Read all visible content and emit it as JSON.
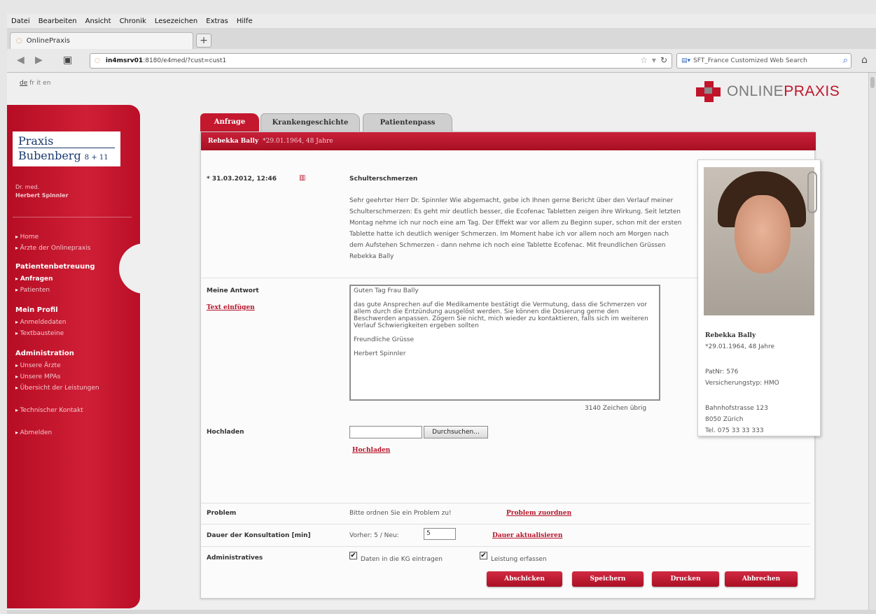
{
  "browser": {
    "menu": [
      "Datei",
      "Bearbeiten",
      "Ansicht",
      "Chronik",
      "Lesezeichen",
      "Extras",
      "Hilfe"
    ],
    "tab_title": "OnlinePraxis",
    "new_tab": "+",
    "url_host": "in4msrv01",
    "url_rest": ":8180/e4med/?cust=cust1",
    "search_placeholder": "SFT_France Customized Web Search"
  },
  "lang": {
    "items": [
      "de",
      "fr",
      "it",
      "en"
    ]
  },
  "brand": {
    "name_gray": "ONLINE",
    "name_red": "PRAXIS",
    "colors": {
      "red": "#c0152b",
      "gray": "#7a7a7a"
    }
  },
  "sidebar": {
    "logo_line1": "Praxis",
    "logo_line2": "Bubenberg",
    "logo_suffix": "8 + 11",
    "doctor_title": "Dr. med.",
    "doctor_name": "Herbert Spinnler",
    "links": {
      "home": "Home",
      "aerzte": "Ärzte der Onlinepraxis",
      "anfragen": "Anfragen",
      "patienten": "Patienten",
      "anmeldedaten": "Anmeldedaten",
      "textbausteine": "Textbausteine",
      "unsere_aerzte": "Unsere Ärzte",
      "unsere_mpas": "Unsere MPAs",
      "uebersicht": "Übersicht der Leistungen",
      "kontakt": "Technischer Kontakt",
      "abmelden": "Abmelden"
    },
    "headings": {
      "patientenbetreuung": "Patientenbetreuung",
      "profil": "Mein Profil",
      "administration": "Administration"
    }
  },
  "tabs": {
    "anfrage": "Anfrage",
    "krankengeschichte": "Krankengeschichte",
    "patientenpass": "Patientenpass"
  },
  "header": {
    "patient": "Rebekka Bally",
    "dob": "*29.01.1964, 48 Jahre"
  },
  "request": {
    "date": "* 31.03.2012, 12:46",
    "subject": "Schulterschmerzen",
    "body": "Sehr geehrter Herr Dr. Spinnler  Wie abgemacht, gebe ich Ihnen gerne Bericht über den Verlauf meiner Schulterschmerzen:  Es geht mir deutlich besser, die Ecofenac Tabletten zeigen ihre Wirkung. Seit letzten Montag nehme ich nur noch eine am Tag. Der Effekt war vor allem zu Beginn super, schon mit der ersten Tablette hatte ich deutlich weniger Schmerzen. Im Moment habe ich vor allem noch am Morgen nach dem Aufstehen Schmerzen - dann nehme ich noch eine Tablette Ecofenac.  Mit freundlichen Grüssen  Rebekka Bally"
  },
  "answer": {
    "label": "Meine Antwort",
    "insert_link": "Text einfügen",
    "text": "Guten Tag Frau Bally\n\ndas gute Ansprechen auf die Medikamente bestätigt die Vermutung, dass die Schmerzen vor allem durch die Entzündung ausgelöst werden. Sie können die Dosierung gerne den Beschwerden anpassen. Zögern Sie nicht, mich wieder zu kontaktieren, falls sich im weiteren Verlauf Schwierigkeiten ergeben sollten\n\nFreundliche Grüsse\n\nHerbert Spinnler",
    "chars_left": "3140 Zeichen übrig"
  },
  "upload": {
    "label": "Hochladen",
    "browse": "Durchsuchen...",
    "link": "Hochladen"
  },
  "problem": {
    "label": "Problem",
    "text": "Bitte ordnen Sie ein Problem zu!",
    "link": "Problem zuordnen"
  },
  "duration": {
    "label": "Dauer der Konsultation [min]",
    "text": "Vorher: 5 / Neu:",
    "value": "5",
    "link": "Dauer aktualisieren"
  },
  "admin": {
    "label": "Administratives",
    "kg": "Daten in die KG eintragen",
    "leistung": "Leistung erfassen"
  },
  "buttons": {
    "send": "Abschicken",
    "save": "Speichern",
    "print": "Drucken",
    "cancel": "Abbrechen"
  },
  "patient_card": {
    "name": "Rebekka Bally",
    "dob": "*29.01.1964, 48 Jahre",
    "patnr": "PatNr: 576",
    "insurance": "Versicherungstyp: HMO",
    "street": "Bahnhofstrasse 123",
    "city": "8050 Zürich",
    "phone": "Tel. 075 33 33 333"
  }
}
